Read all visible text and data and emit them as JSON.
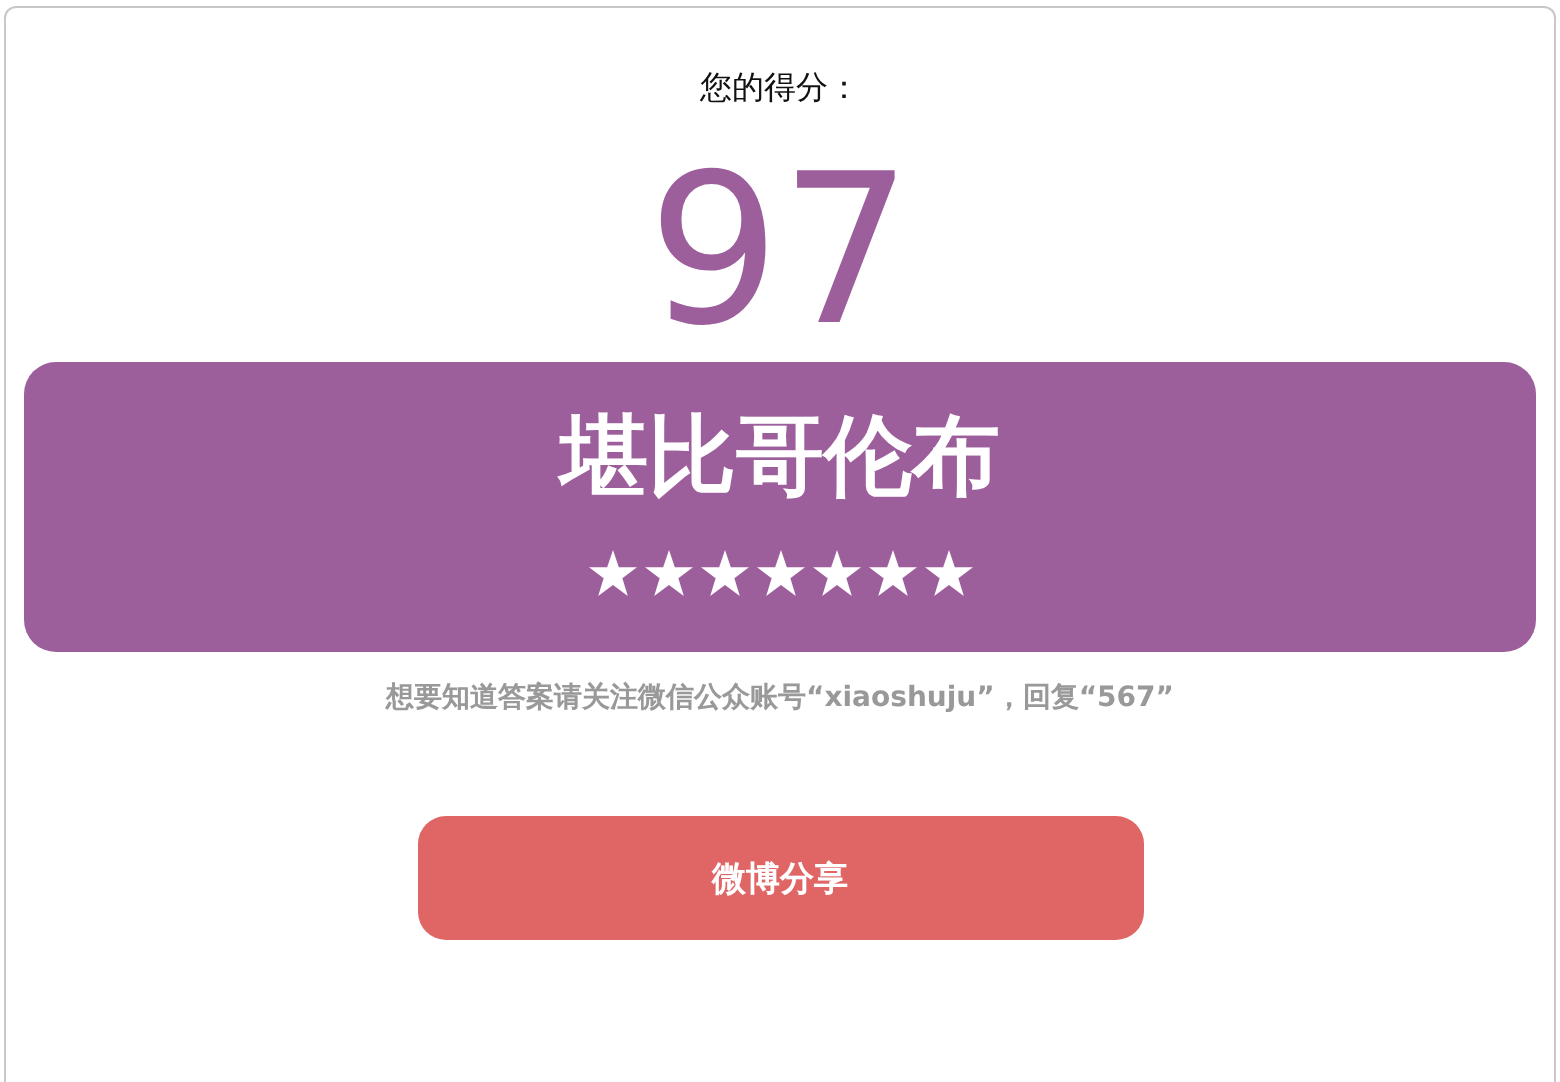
{
  "score_label": "您的得分：",
  "score": "97",
  "result": {
    "title": "堪比哥伦布",
    "stars": 7
  },
  "hint": "想要知道答案请关注微信公众账号“xiaoshuju”，回复“567”",
  "share_button": {
    "label": "微博分享"
  }
}
